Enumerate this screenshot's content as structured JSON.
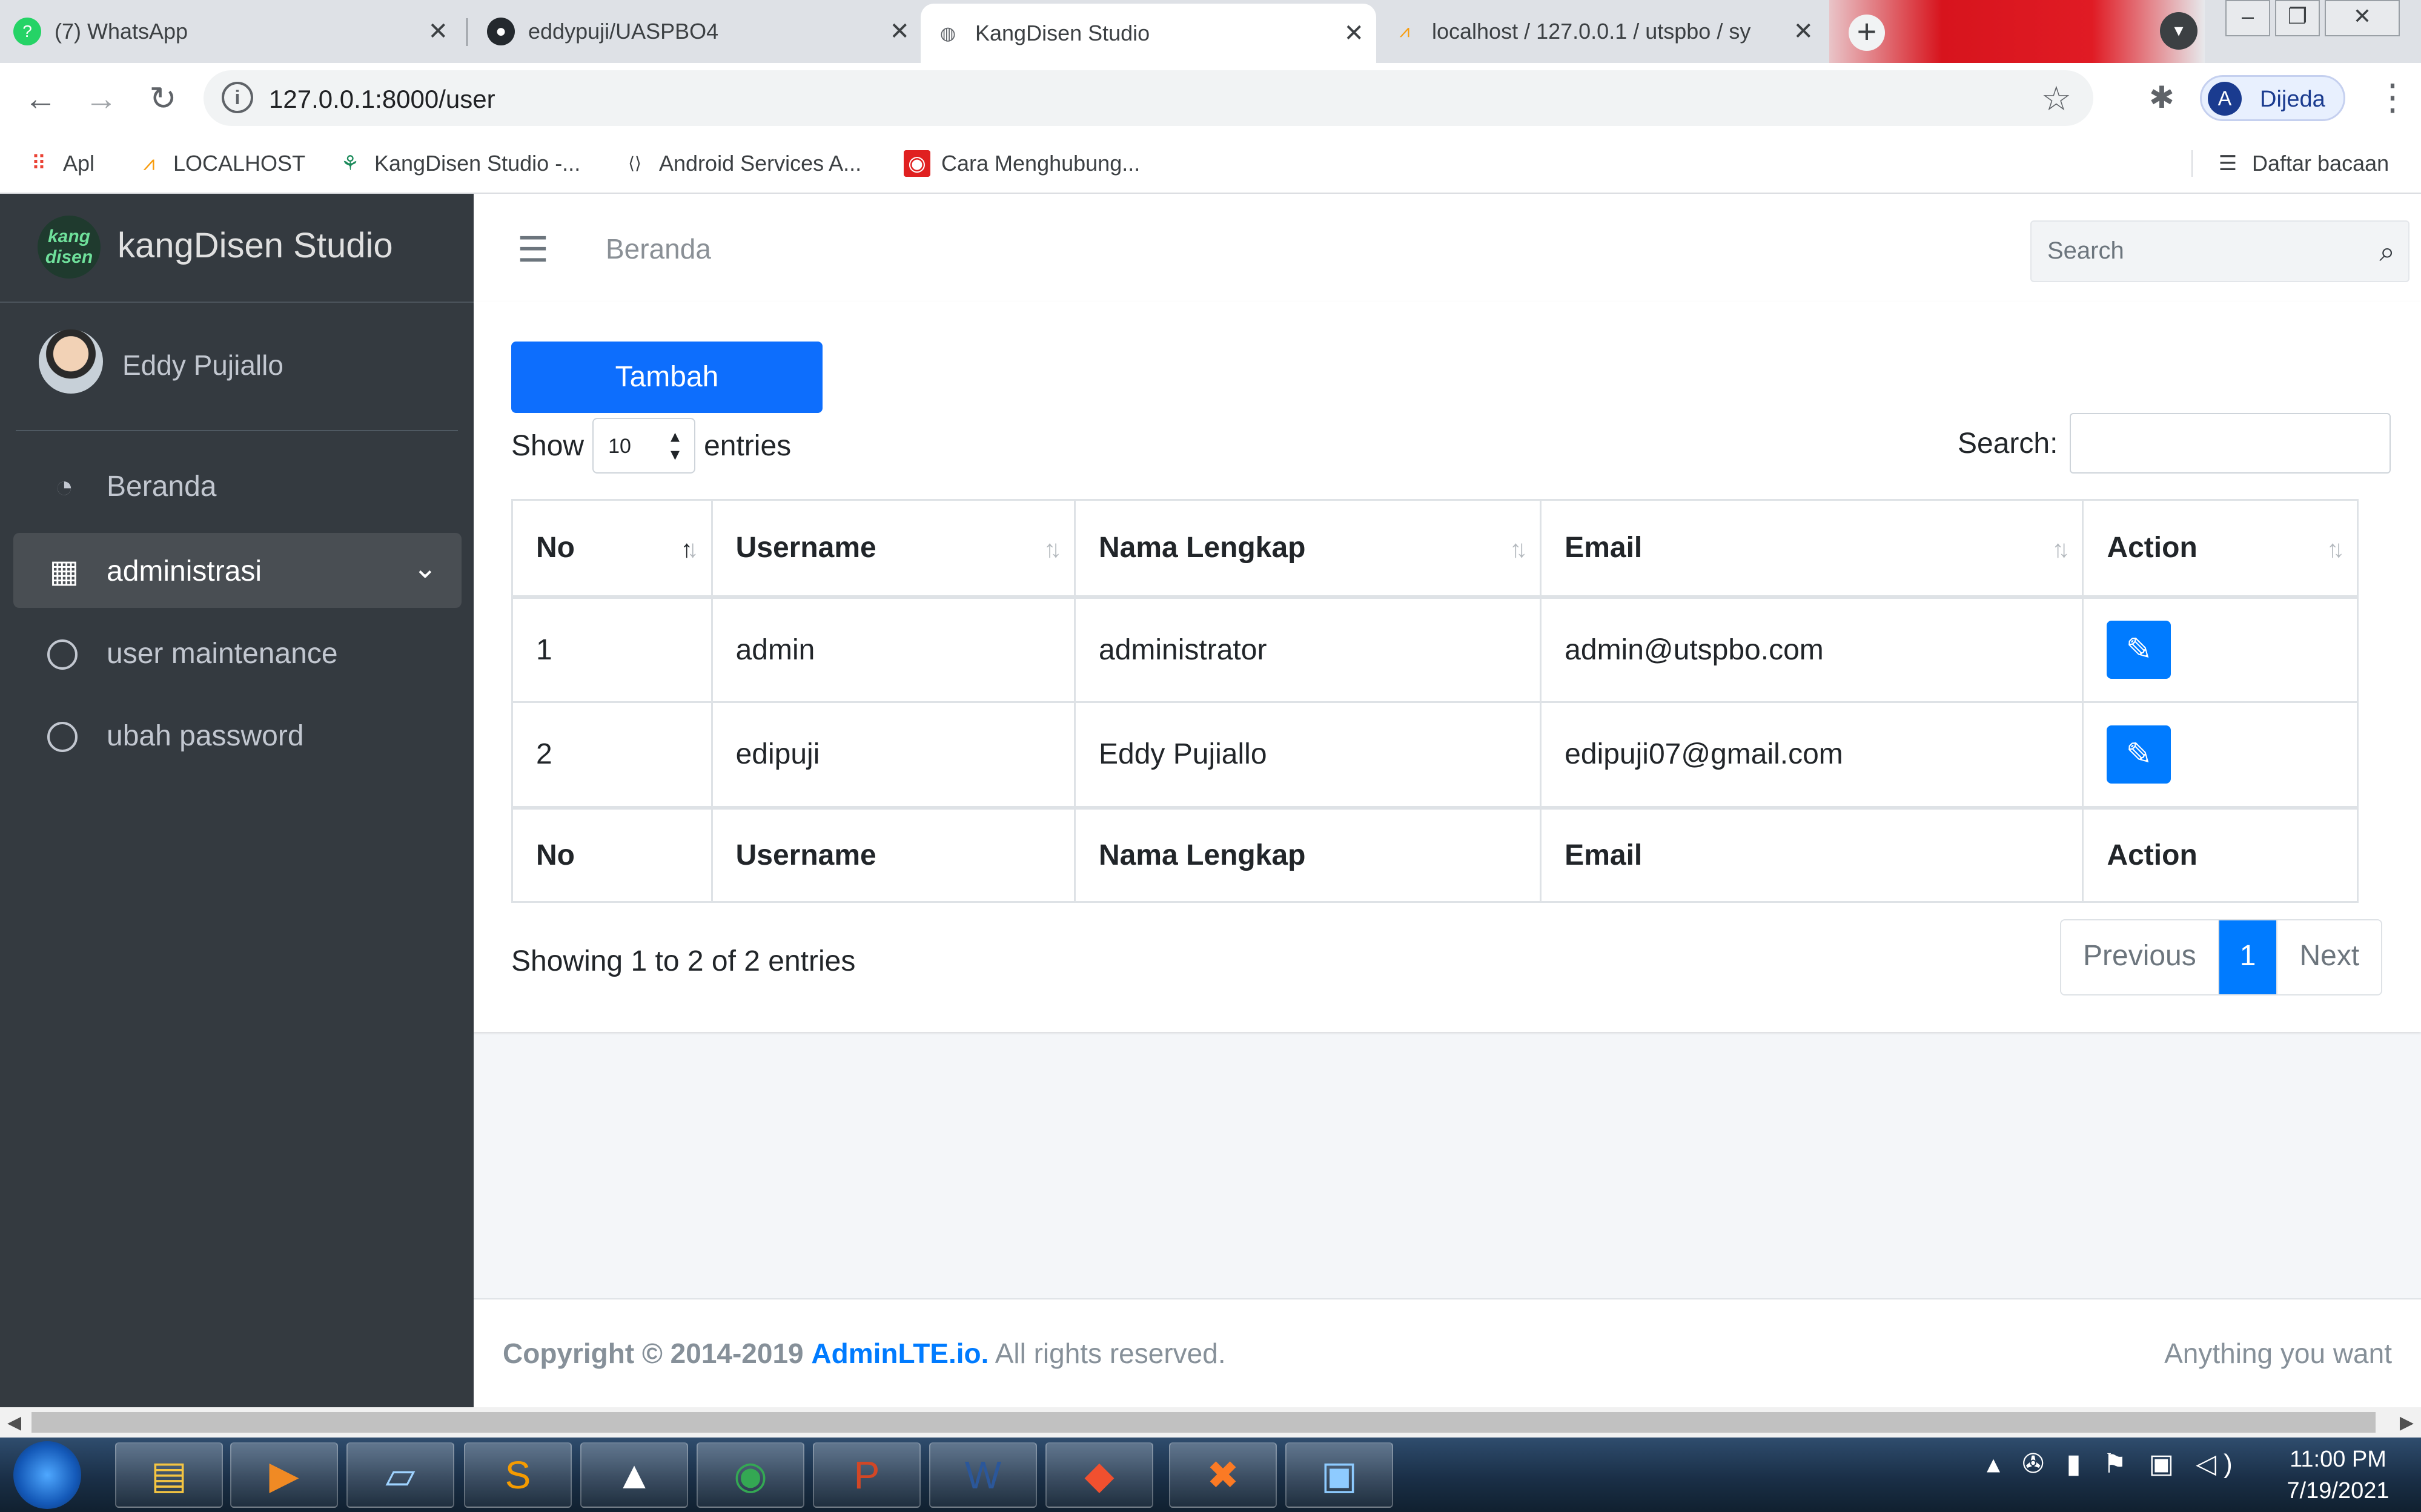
{
  "browser": {
    "tabs": [
      {
        "title": "(7) WhatsApp",
        "icon": "whatsapp-icon"
      },
      {
        "title": "eddypuji/UASPBO4",
        "icon": "github-icon"
      },
      {
        "title": "KangDisen Studio",
        "icon": "globe-icon",
        "active": true
      },
      {
        "title": "localhost / 127.0.0.1 / utspbo / sy",
        "icon": "phpmyadmin-icon"
      }
    ],
    "url": "127.0.0.1:8000/user",
    "profile_name": "Dijeda",
    "profile_initial": "A",
    "bookmarks": [
      {
        "label": "Apl",
        "icon": "apps-grid-icon"
      },
      {
        "label": "LOCALHOST",
        "icon": "phpmyadmin-icon"
      },
      {
        "label": "KangDisen Studio -...",
        "icon": "site-icon"
      },
      {
        "label": "Android Services A...",
        "icon": "code-icon"
      },
      {
        "label": "Cara Menghubung...",
        "icon": "record-icon"
      }
    ],
    "reading_list": "Daftar bacaan"
  },
  "sidebar": {
    "brand": "kangDisen Studio",
    "logo_text": "kang disen",
    "user_name": "Eddy Pujiallo",
    "items": [
      {
        "label": "Beranda",
        "icon": "dashboard-icon"
      },
      {
        "label": "administrasi",
        "icon": "grid-icon",
        "open": true
      },
      {
        "label": "user maintenance",
        "icon": "circle-icon"
      },
      {
        "label": "ubah password",
        "icon": "circle-icon"
      }
    ]
  },
  "header": {
    "breadcrumb": "Beranda",
    "search_placeholder": "Search"
  },
  "content": {
    "add_button": "Tambah",
    "show_label": "Show",
    "page_length": "10",
    "entries_label": "entries",
    "search_label": "Search:",
    "columns": [
      "No",
      "Username",
      "Nama Lengkap",
      "Email",
      "Action"
    ],
    "rows": [
      {
        "no": "1",
        "username": "admin",
        "nama": "administrator",
        "email": "admin@utspbo.com"
      },
      {
        "no": "2",
        "username": "edipuji",
        "nama": "Eddy Pujiallo",
        "email": "edipuji07@gmail.com"
      }
    ],
    "info": "Showing 1 to 2 of 2 entries",
    "pagination": {
      "previous": "Previous",
      "current": "1",
      "next": "Next"
    }
  },
  "footer": {
    "copyright": "Copyright © 2014-2019",
    "link": "AdminLTE.io.",
    "rights": "All rights reserved.",
    "right_text": "Anything you want"
  },
  "taskbar": {
    "time": "11:00 PM",
    "date": "7/19/2021",
    "apps": [
      "file-explorer-icon",
      "media-player-icon",
      "notepad-icon",
      "sublime-icon",
      "inkscape-icon",
      "chrome-icon",
      "powerpoint-icon",
      "word-icon",
      "git-icon",
      "xampp-icon",
      "photo-viewer-icon"
    ]
  },
  "colors": {
    "primary": "#007bff",
    "button_primary": "#0d6efd",
    "sidebar_bg": "#343a40",
    "content_bg": "#f4f6f9"
  }
}
